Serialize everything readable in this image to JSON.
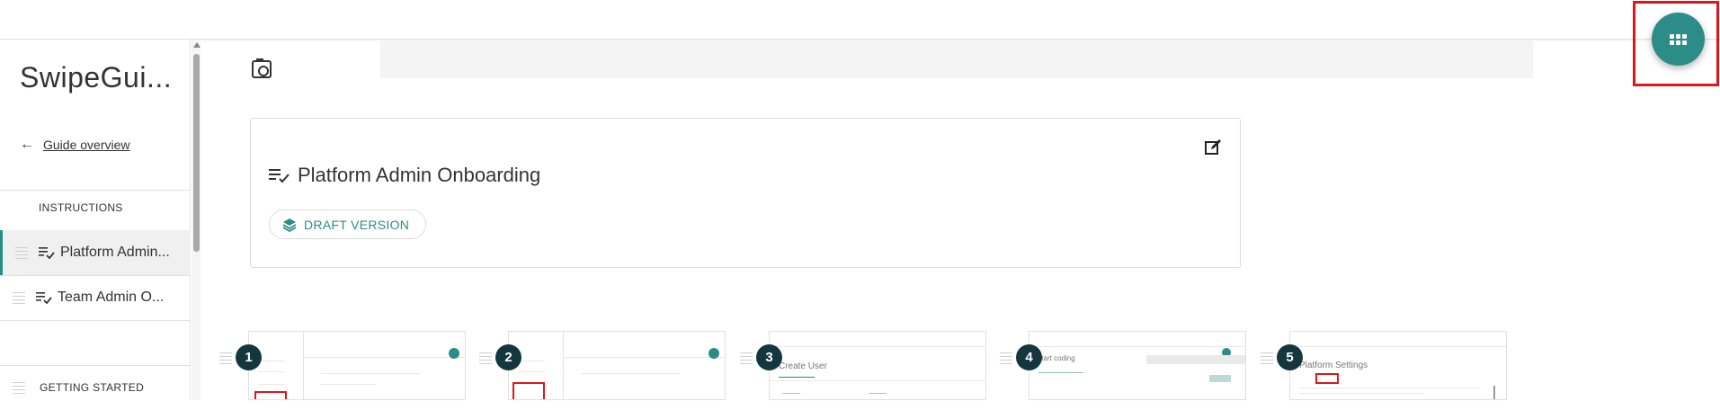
{
  "app": {
    "guide_title": "SwipeGui...",
    "fab_icon": "apps-grid-icon",
    "accent_color": "#2b8c88",
    "highlight_color": "#e0161b"
  },
  "sidebar": {
    "back_label": "Guide overview",
    "instructions_label": "INSTRUCTIONS",
    "items": [
      {
        "label": "Platform Admin...",
        "active": true
      },
      {
        "label": "Team Admin O...",
        "active": false
      }
    ],
    "getting_started_label": "GETTING STARTED"
  },
  "card": {
    "title": "Platform Admin Onboarding",
    "badge": "DRAFT VERSION"
  },
  "steps": [
    {
      "number": "1"
    },
    {
      "number": "2"
    },
    {
      "number": "3",
      "thumb_title": "Create User"
    },
    {
      "number": "4",
      "thumb_title": "Start coding"
    },
    {
      "number": "5",
      "thumb_title": "Platform Settings"
    }
  ]
}
